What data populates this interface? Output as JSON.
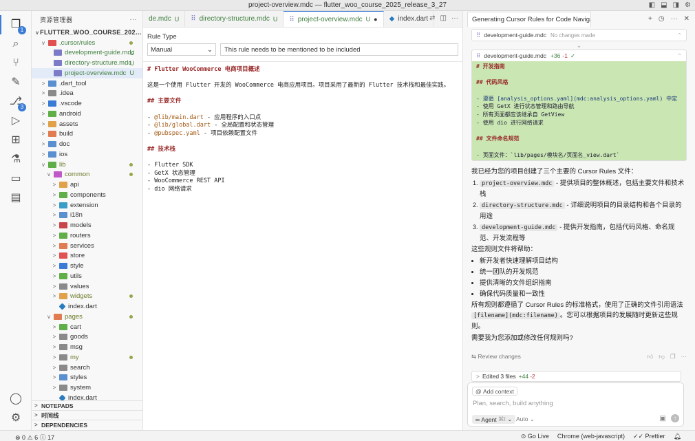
{
  "window": {
    "title": "project-overview.mdc — flutter_woo_course_2025_release_3_27"
  },
  "activity": {
    "explorer_badge": "1",
    "scm_badge": "3"
  },
  "sidebar": {
    "header": "资源管理器",
    "root": "FLUTTER_WOO_COURSE_2025_RELE...",
    "items": [
      {
        "label": ".cursor/rules",
        "depth": 1,
        "chev": "v",
        "status": "",
        "color": "#e05252",
        "style": "green",
        "dot": true
      },
      {
        "label": "development-guide.mdc",
        "depth": 2,
        "chev": "",
        "status": "U",
        "color": "#7b7bc8",
        "style": "green"
      },
      {
        "label": "directory-structure.mdc",
        "depth": 2,
        "chev": "",
        "status": "U",
        "color": "#7b7bc8",
        "style": "green"
      },
      {
        "label": "project-overview.mdc",
        "depth": 2,
        "chev": "",
        "status": "U",
        "color": "#7b7bc8",
        "style": "green",
        "selected": true
      },
      {
        "label": ".dart_tool",
        "depth": 1,
        "chev": ">",
        "status": "",
        "color": "#5a8fd0"
      },
      {
        "label": ".idea",
        "depth": 1,
        "chev": ">",
        "status": "",
        "color": "#8a8a8a"
      },
      {
        "label": ".vscode",
        "depth": 1,
        "chev": ">",
        "status": "",
        "color": "#3a7bd5"
      },
      {
        "label": "android",
        "depth": 1,
        "chev": ">",
        "status": "",
        "color": "#5fae47"
      },
      {
        "label": "assets",
        "depth": 1,
        "chev": ">",
        "status": "",
        "color": "#e0a14a"
      },
      {
        "label": "build",
        "depth": 1,
        "chev": ">",
        "status": "",
        "color": "#e07b52"
      },
      {
        "label": "doc",
        "depth": 1,
        "chev": ">",
        "status": "",
        "color": "#5a8fd0"
      },
      {
        "label": "ios",
        "depth": 1,
        "chev": ">",
        "status": "",
        "color": "#5a8fd0"
      },
      {
        "label": "lib",
        "depth": 1,
        "chev": "v",
        "status": "",
        "color": "#5fae47",
        "style": "olive",
        "dot": true
      },
      {
        "label": "common",
        "depth": 2,
        "chev": "v",
        "status": "",
        "color": "#c05ac8",
        "style": "olive",
        "dot": true
      },
      {
        "label": "api",
        "depth": 3,
        "chev": ">",
        "status": "",
        "color": "#e0a14a"
      },
      {
        "label": "components",
        "depth": 3,
        "chev": ">",
        "status": "",
        "color": "#5fae47"
      },
      {
        "label": "extension",
        "depth": 3,
        "chev": ">",
        "status": "",
        "color": "#3a9dc8"
      },
      {
        "label": "i18n",
        "depth": 3,
        "chev": ">",
        "status": "",
        "color": "#5a8fd0"
      },
      {
        "label": "models",
        "depth": 3,
        "chev": ">",
        "status": "",
        "color": "#c8454a"
      },
      {
        "label": "routers",
        "depth": 3,
        "chev": ">",
        "status": "",
        "color": "#5fae47"
      },
      {
        "label": "services",
        "depth": 3,
        "chev": ">",
        "status": "",
        "color": "#e07b52"
      },
      {
        "label": "store",
        "depth": 3,
        "chev": ">",
        "status": "",
        "color": "#e05252"
      },
      {
        "label": "style",
        "depth": 3,
        "chev": ">",
        "status": "",
        "color": "#3a7bd5"
      },
      {
        "label": "utils",
        "depth": 3,
        "chev": ">",
        "status": "",
        "color": "#5fae47"
      },
      {
        "label": "values",
        "depth": 3,
        "chev": ">",
        "status": "",
        "color": "#8a8a8a"
      },
      {
        "label": "widgets",
        "depth": 3,
        "chev": ">",
        "status": "",
        "color": "#e0a14a",
        "style": "olive",
        "dot": true
      },
      {
        "label": "index.dart",
        "depth": 3,
        "chev": "",
        "status": "",
        "color": "#2b7bbf",
        "file": true
      },
      {
        "label": "pages",
        "depth": 2,
        "chev": "v",
        "status": "",
        "color": "#e07b52",
        "style": "olive",
        "dot": true
      },
      {
        "label": "cart",
        "depth": 3,
        "chev": ">",
        "status": "",
        "color": "#5fae47"
      },
      {
        "label": "goods",
        "depth": 3,
        "chev": ">",
        "status": "",
        "color": "#8a8a8a"
      },
      {
        "label": "msg",
        "depth": 3,
        "chev": ">",
        "status": "",
        "color": "#8a8a8a"
      },
      {
        "label": "my",
        "depth": 3,
        "chev": ">",
        "status": "",
        "color": "#8a8a8a",
        "style": "olive",
        "dot": true
      },
      {
        "label": "search",
        "depth": 3,
        "chev": ">",
        "status": "",
        "color": "#8a8a8a"
      },
      {
        "label": "styles",
        "depth": 3,
        "chev": ">",
        "status": "",
        "color": "#5a8fd0"
      },
      {
        "label": "system",
        "depth": 3,
        "chev": ">",
        "status": "",
        "color": "#8a8a8a"
      },
      {
        "label": "index.dart",
        "depth": 3,
        "chev": "",
        "status": "",
        "color": "#2b7bbf",
        "file": true
      }
    ],
    "footers": [
      "NOTEPADS",
      "时间线",
      "DEPENDENCIES"
    ]
  },
  "editor": {
    "tabs": [
      {
        "label": "de.mdc",
        "status": "U",
        "kind": "mdc"
      },
      {
        "label": "directory-structure.mdc",
        "status": "U",
        "kind": "mdc"
      },
      {
        "label": "project-overview.mdc",
        "status": "U",
        "kind": "mdc",
        "active": true,
        "dirty": "●"
      },
      {
        "label": "index.dart",
        "status": "",
        "kind": "dart"
      }
    ],
    "rule_type_label": "Rule Type",
    "rule_type_value": "Manual",
    "rule_description": "This rule needs to be mentioned to be included",
    "lines": [
      {
        "t": "# Flutter WooCommerce 电商项目概述",
        "k": "h"
      },
      {
        "t": "",
        "k": "blank"
      },
      {
        "t": "这是一个使用 Flutter 开发的 WooCommerce 电商应用项目。项目采用了最新的 Flutter 技术栈和最佳实践。",
        "k": ""
      },
      {
        "t": "",
        "k": "blank"
      },
      {
        "t": "## 主要文件",
        "k": "h"
      },
      {
        "t": "",
        "k": "blank"
      },
      {
        "t": "- @lib/main.dart - 应用程序的入口点",
        "k": "code"
      },
      {
        "t": "- @lib/global.dart - 全局配置和状态管理",
        "k": "code"
      },
      {
        "t": "- @pubspec.yaml - 项目依赖配置文件",
        "k": "code"
      },
      {
        "t": "",
        "k": "blank"
      },
      {
        "t": "## 技术栈",
        "k": "h"
      },
      {
        "t": "",
        "k": "blank"
      },
      {
        "t": "- Flutter SDK",
        "k": ""
      },
      {
        "t": "- GetX 状态管理",
        "k": ""
      },
      {
        "t": "- WooCommerce REST API",
        "k": ""
      },
      {
        "t": "- dio 网络请求",
        "k": ""
      }
    ]
  },
  "chat": {
    "tab_title": "Generating Cursor Rules for Code Navigati",
    "card1": {
      "file": "development-guide.mdc",
      "note": "No changes made"
    },
    "card2": {
      "file": "development-guide.mdc",
      "added": "+36",
      "removed": "-1",
      "check": "✓"
    },
    "diff_lines": [
      {
        "t": "# 开发指南",
        "k": "dh"
      },
      {
        "t": "",
        "k": ""
      },
      {
        "t": "## 代码风格",
        "k": "dh"
      },
      {
        "t": "",
        "k": ""
      },
      {
        "t": "- 遵循 [analysis_options.yaml](mdc:analysis_options.yaml) 中定",
        "k": "dc"
      },
      {
        "t": "- 使用 GetX 进行状态管理和路由导航",
        "k": ""
      },
      {
        "t": "- 所有页面都应该继承自 GetView",
        "k": ""
      },
      {
        "t": "- 使用 dio 进行网络请求",
        "k": ""
      },
      {
        "t": "",
        "k": ""
      },
      {
        "t": "## 文件命名规范",
        "k": "dh"
      },
      {
        "t": "",
        "k": ""
      },
      {
        "t": "- 页面文件：`lib/pages/模块名/页面名_view.dart`",
        "k": ""
      }
    ],
    "intro": "我已经为您的项目创建了三个主要的 Cursor Rules 文件：",
    "ol": [
      {
        "code": "project-overview.mdc",
        "text": " - 提供项目的整体概述，包括主要文件和技术栈"
      },
      {
        "code": "directory-structure.mdc",
        "text": " - 详细说明项目的目录结构和各个目录的用途"
      },
      {
        "code": "development-guide.mdc",
        "text": " - 提供开发指南，包括代码风格、命名规范、开发流程等"
      }
    ],
    "help_intro": "这些规则文件将帮助：",
    "ul": [
      "新开发者快速理解项目结构",
      "统一团队的开发规范",
      "提供清晰的文件组织指南",
      "确保代码质量和一致性"
    ],
    "closing_a": "所有规则都遵循了 Cursor Rules 的标准格式，使用了正确的文件引用语法 ",
    "closing_code": "[filename](mdc:filename)",
    "closing_b": "。您可以根据项目的发展随时更新这些规则。",
    "question": "需要我为您添加或修改任何规则吗?",
    "review_label": "Review changes",
    "edited": {
      "label": "Edited 3 files",
      "added": "+44",
      "removed": "-2"
    },
    "composer": {
      "add_context": "Add context",
      "placeholder": "Plan, search, build anything",
      "agent": "Agent",
      "agent_shortcut": "⌘I",
      "auto": "Auto"
    }
  },
  "status": {
    "errors": "0",
    "warnings": "6",
    "info": "17",
    "go_live": "Go Live",
    "device": "Chrome (web-javascript)",
    "prettier": "Prettier"
  }
}
